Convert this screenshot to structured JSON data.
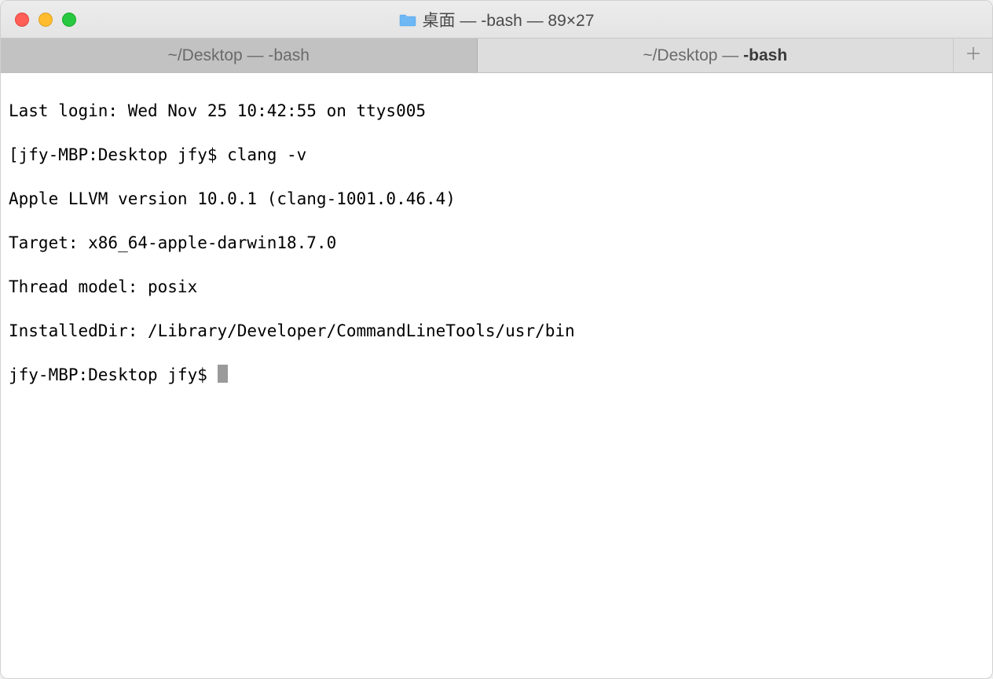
{
  "titlebar": {
    "title": "桌面 — -bash — 89×27"
  },
  "tabs": {
    "tab1_prefix": "~/Desktop — ",
    "tab1_name": "-bash",
    "tab2_prefix": "~/Desktop — ",
    "tab2_name": "-bash"
  },
  "terminal": {
    "lines": [
      "Last login: Wed Nov 25 10:42:55 on ttys005",
      "[jfy-MBP:Desktop jfy$ clang -v",
      "Apple LLVM version 10.0.1 (clang-1001.0.46.4)",
      "Target: x86_64-apple-darwin18.7.0",
      "Thread model: posix",
      "InstalledDir: /Library/Developer/CommandLineTools/usr/bin"
    ],
    "prompt": "jfy-MBP:Desktop jfy$ "
  }
}
